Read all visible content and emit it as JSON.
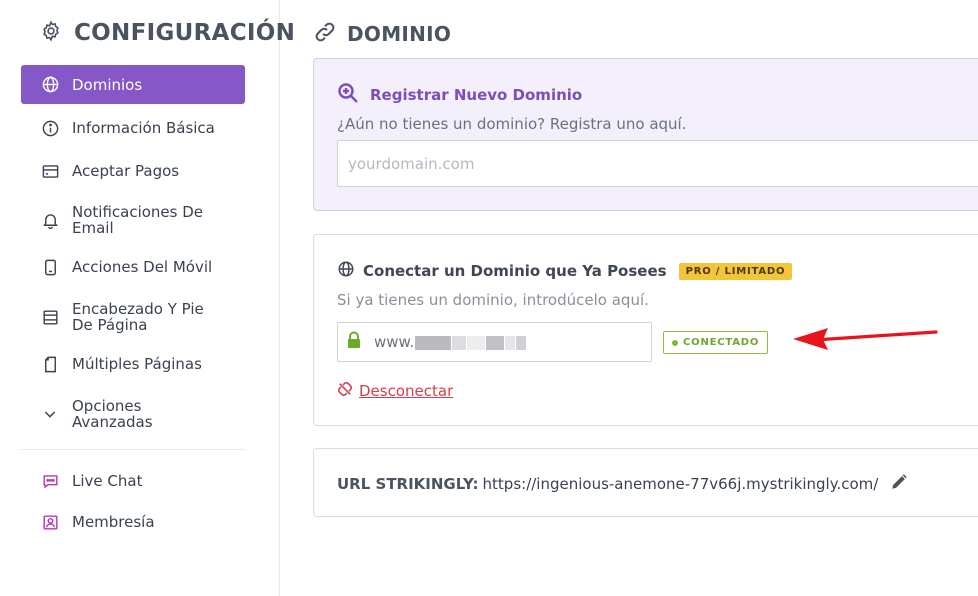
{
  "sidebar": {
    "title": "CONFIGURACIÓN",
    "items": [
      {
        "label": "Dominios"
      },
      {
        "label": "Información Básica"
      },
      {
        "label": "Aceptar Pagos"
      },
      {
        "label": "Notificaciones De Email"
      },
      {
        "label": "Acciones Del Móvil"
      },
      {
        "label": "Encabezado Y Pie De Página"
      },
      {
        "label": "Múltiples Páginas"
      },
      {
        "label": "Opciones Avanzadas"
      }
    ],
    "extras": [
      {
        "label": "Live Chat"
      },
      {
        "label": "Membresía"
      }
    ]
  },
  "main": {
    "title": "DOMINIO",
    "register": {
      "title": "Registrar Nuevo Dominio",
      "subtitle": "¿Aún no tienes un dominio? Registra uno aquí.",
      "placeholder": "yourdomain.com",
      "value": ""
    },
    "connect": {
      "title": "Conectar un Dominio que Ya Posees",
      "badge": "PRO / LIMITADO",
      "subtitle": "Si ya tienes un dominio, introdúcelo aquí.",
      "domain_prefix": "www.",
      "status": "CONECTADO",
      "disconnect": "Desconectar"
    },
    "url": {
      "label": "URL STRIKINGLY:",
      "value": "https://ingenious-anemone-77v66j.mystrikingly.com/"
    }
  },
  "colors": {
    "accent": "#8557c7",
    "badge_pro": "#f3c53c",
    "connected": "#7cb82f",
    "danger": "#d2404a",
    "arrow": "#e8141b"
  }
}
